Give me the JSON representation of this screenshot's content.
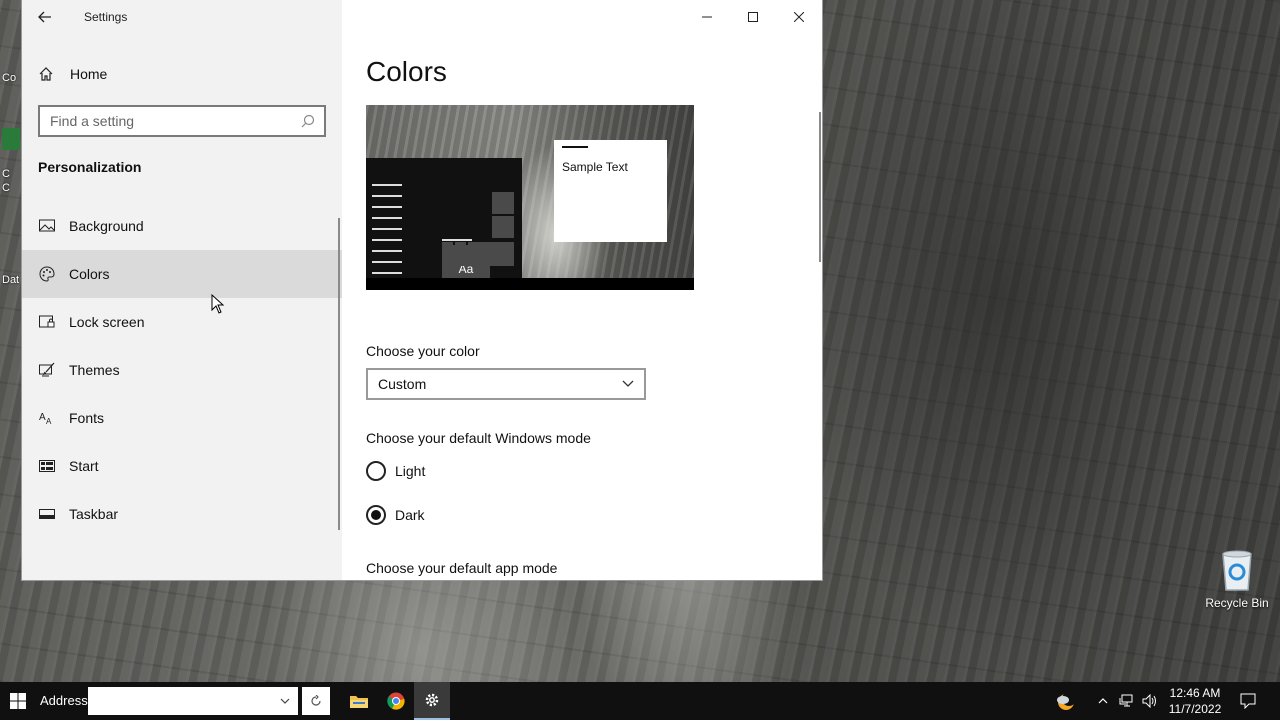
{
  "window": {
    "title": "Settings",
    "minimize_icon": "minimize-icon",
    "maximize_icon": "maximize-icon",
    "close_icon": "close-icon"
  },
  "sidebar": {
    "home_label": "Home",
    "search_placeholder": "Find a setting",
    "section_title": "Personalization",
    "items": [
      {
        "label": "Background",
        "icon": "picture-icon"
      },
      {
        "label": "Colors",
        "icon": "palette-icon",
        "active": true
      },
      {
        "label": "Lock screen",
        "icon": "lock-screen-icon"
      },
      {
        "label": "Themes",
        "icon": "brush-icon"
      },
      {
        "label": "Fonts",
        "icon": "font-icon"
      },
      {
        "label": "Start",
        "icon": "start-icon"
      },
      {
        "label": "Taskbar",
        "icon": "taskbar-icon"
      }
    ]
  },
  "main": {
    "title": "Colors",
    "preview": {
      "tile_text": "Aa",
      "sample_text": "Sample Text"
    },
    "choose_color_label": "Choose your color",
    "color_value": "Custom",
    "windows_mode_label": "Choose your default Windows mode",
    "modes": [
      {
        "label": "Light",
        "selected": false
      },
      {
        "label": "Dark",
        "selected": true
      }
    ],
    "app_mode_label": "Choose your default app mode"
  },
  "desktop": {
    "recycle_bin_label": "Recycle Bin",
    "left_fragments": [
      "Co",
      "C",
      "C",
      "Dat"
    ]
  },
  "taskbar": {
    "address_label": "Address",
    "address_value": "",
    "time": "12:46 AM",
    "date": "11/7/2022"
  },
  "colors": {
    "taskbar_bg": "#101010",
    "sidebar_bg": "#f2f2f2",
    "active_item_bg": "#dadada"
  }
}
